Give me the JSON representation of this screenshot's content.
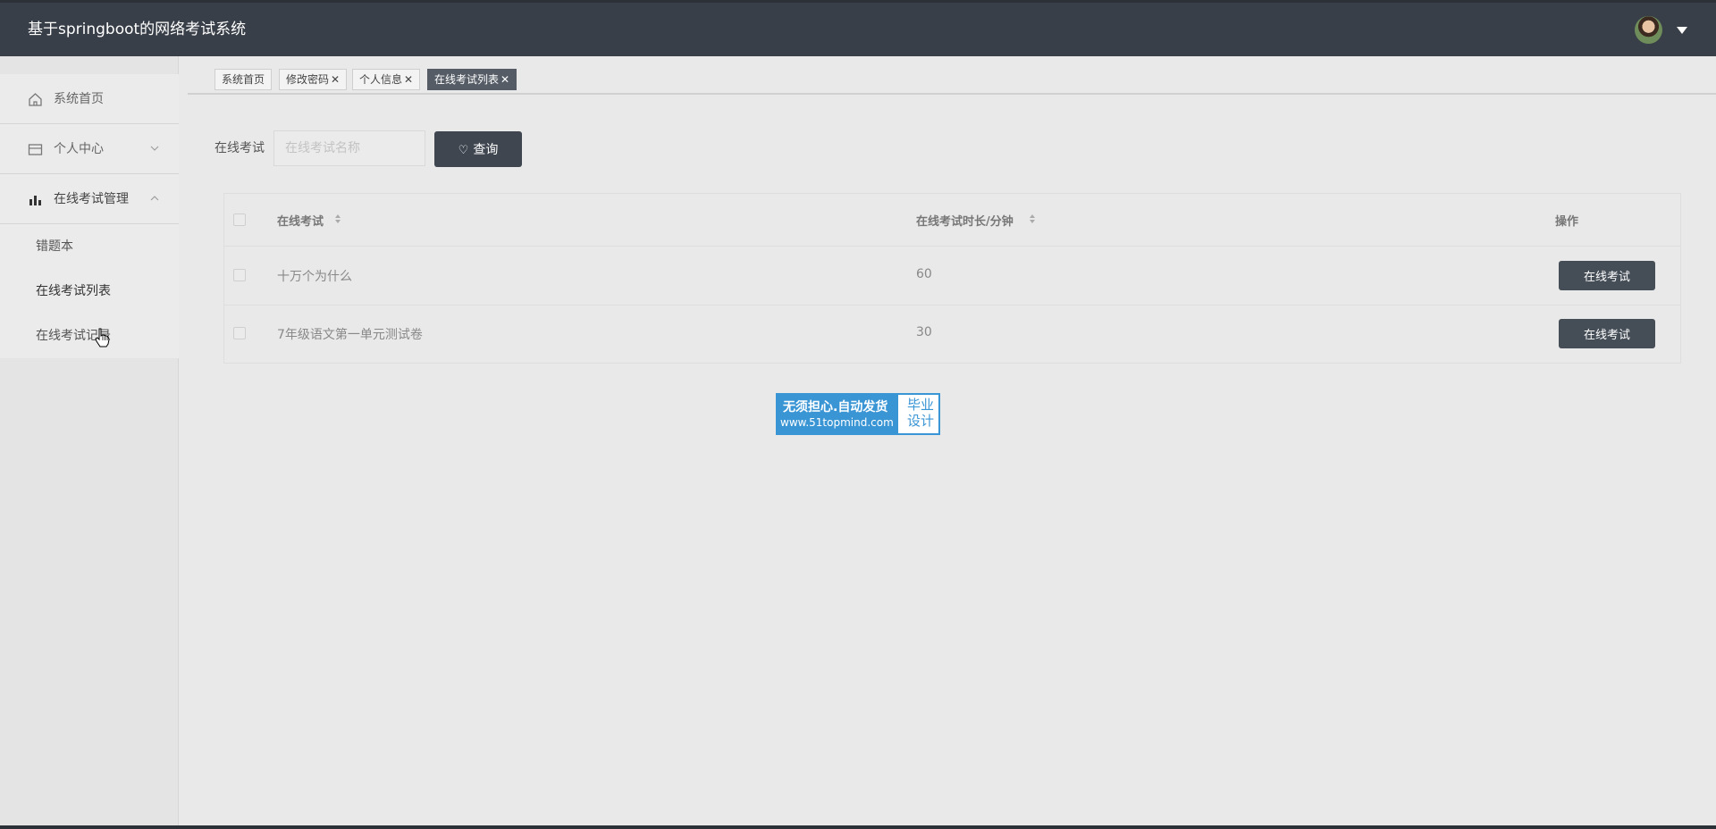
{
  "header": {
    "title": "基于springboot的网络考试系统",
    "avatar": "user-avatar",
    "dropdown_icon": "caret-down-icon"
  },
  "sidebar": {
    "items": [
      {
        "label": "系统首页",
        "icon": "home-icon"
      },
      {
        "label": "个人中心",
        "icon": "id-card-icon",
        "arrow": "chevron-down-icon"
      },
      {
        "label": "在线考试管理",
        "icon": "bar-chart-icon",
        "arrow": "chevron-up-icon"
      }
    ],
    "sub_items": [
      {
        "label": "错题本"
      },
      {
        "label": "在线考试列表"
      },
      {
        "label": "在线考试记录"
      }
    ]
  },
  "tabs": [
    {
      "label": "系统首页",
      "closable": false
    },
    {
      "label": "修改密码",
      "closable": true
    },
    {
      "label": "个人信息",
      "closable": true
    },
    {
      "label": "在线考试列表",
      "closable": true,
      "active": true
    }
  ],
  "tab_close_glyph": "✕",
  "search": {
    "label": "在线考试",
    "placeholder": "在线考试名称",
    "value": "",
    "button_label": "查询",
    "button_icon": "heart-icon"
  },
  "table": {
    "columns": [
      "在线考试",
      "在线考试时长/分钟",
      "操作"
    ],
    "rows": [
      {
        "name": "十万个为什么",
        "duration": "60",
        "action": "在线考试"
      },
      {
        "name": "7年级语文第一单元测试卷",
        "duration": "30",
        "action": "在线考试"
      }
    ]
  },
  "ad": {
    "line1": "无须担心.自动发货",
    "line2": "www.51topmind.com",
    "right1": "毕业",
    "right2": "设计"
  },
  "colors": {
    "header_bg": "#393f48",
    "button_bg": "#3f4650",
    "ad_blue": "#3a95d5"
  }
}
